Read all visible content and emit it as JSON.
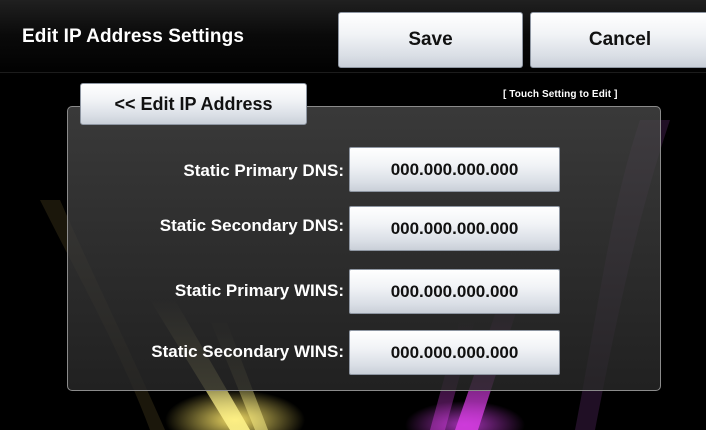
{
  "header": {
    "title": "Edit IP Address Settings",
    "save_label": "Save",
    "cancel_label": "Cancel"
  },
  "panel": {
    "back_label": "<< Edit IP Address",
    "hint": "[ Touch Setting to Edit ]",
    "rows": [
      {
        "label": "Static Primary DNS:",
        "value": "000.000.000.000"
      },
      {
        "label": "Static Secondary DNS:",
        "value": "000.000.000.000"
      },
      {
        "label": "Static Primary WINS:",
        "value": "000.000.000.000"
      },
      {
        "label": "Static Secondary WINS:",
        "value": "000.000.000.000"
      }
    ]
  },
  "colors": {
    "background": "#000000",
    "text": "#ffffff",
    "button_top": "#ffffff",
    "button_bottom": "#c9cfd8",
    "panel_border": "#8b8b8b"
  }
}
